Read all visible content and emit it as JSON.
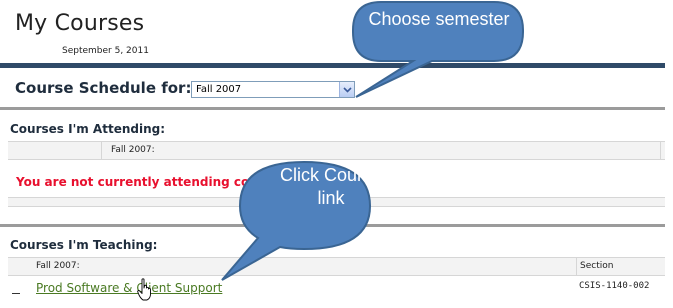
{
  "page": {
    "title": "My Courses",
    "date": "September 5, 2011"
  },
  "schedule": {
    "label": "Course Schedule for:",
    "selected_semester": "Fall 2007"
  },
  "attending": {
    "heading": "Courses I'm Attending:",
    "term_header": "Fall 2007:",
    "notice": "You are not currently attending courses"
  },
  "teaching": {
    "heading": "Courses I'm Teaching:",
    "term_header": "Fall 2007:",
    "section_header": "Section",
    "rows": [
      {
        "course_name": "Prod Software & Client Support",
        "section": "CSIS-1140-002"
      }
    ]
  },
  "callouts": {
    "choose_semester": "Choose semester",
    "click_course_link": "Click Course link"
  },
  "colors": {
    "callout_fill": "#4f81bd",
    "callout_border": "#3a6593",
    "header_rule": "#2f4a68",
    "notice_red": "#e8102e",
    "link_green": "#4a7a23"
  }
}
